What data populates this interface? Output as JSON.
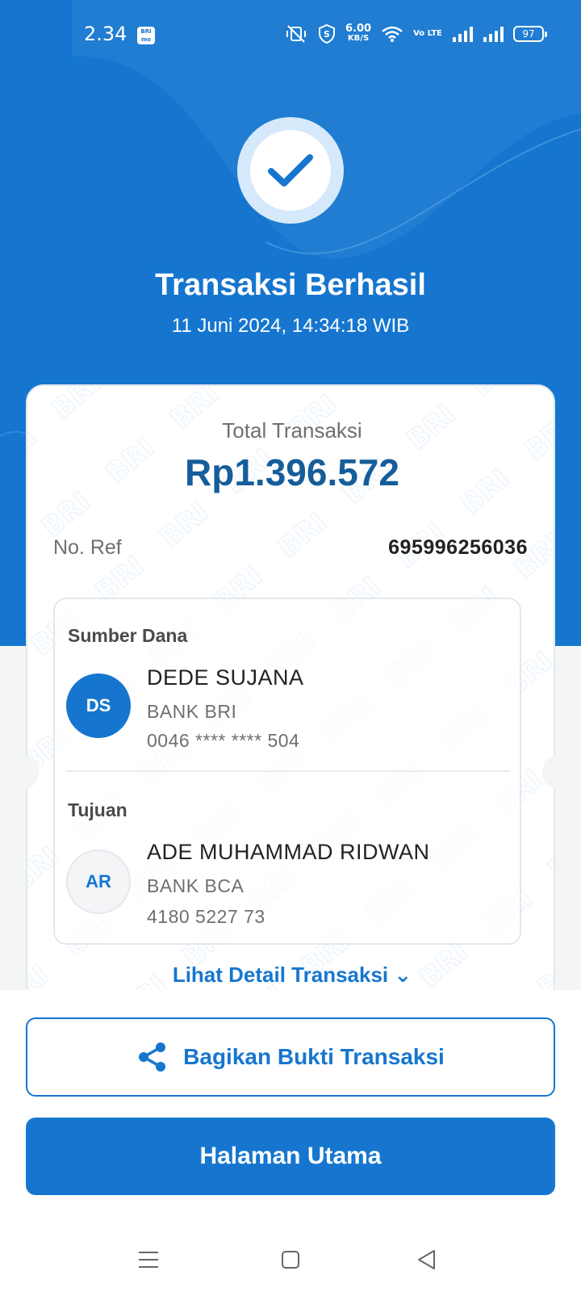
{
  "status_bar": {
    "time": "2.34",
    "app_badge": "BRI mo",
    "net_speed": "6.00",
    "net_speed_unit": "KB/S",
    "lte": "Vo LTE",
    "battery": "97"
  },
  "header": {
    "title": "Transaksi Berhasil",
    "datetime": "11 Juni 2024, 14:34:18 WIB"
  },
  "receipt": {
    "total_label": "Total Transaksi",
    "total_amount": "Rp1.396.572",
    "ref_label": "No. Ref",
    "ref_value": "695996256036",
    "source": {
      "section_label": "Sumber Dana",
      "initials": "DS",
      "name": "DEDE SUJANA",
      "bank": "BANK BRI",
      "account": "0046 **** **** 504"
    },
    "destination": {
      "section_label": "Tujuan",
      "initials": "AR",
      "name": "ADE MUHAMMAD RIDWAN",
      "bank": "BANK BCA",
      "account": "4180 5227 73"
    },
    "detail_link": "Lihat Detail Transaksi"
  },
  "actions": {
    "share_label": "Bagikan Bukti Transaksi",
    "home_label": "Halaman Utama"
  },
  "colors": {
    "primary": "#1676cf",
    "amount": "#155d9b"
  }
}
